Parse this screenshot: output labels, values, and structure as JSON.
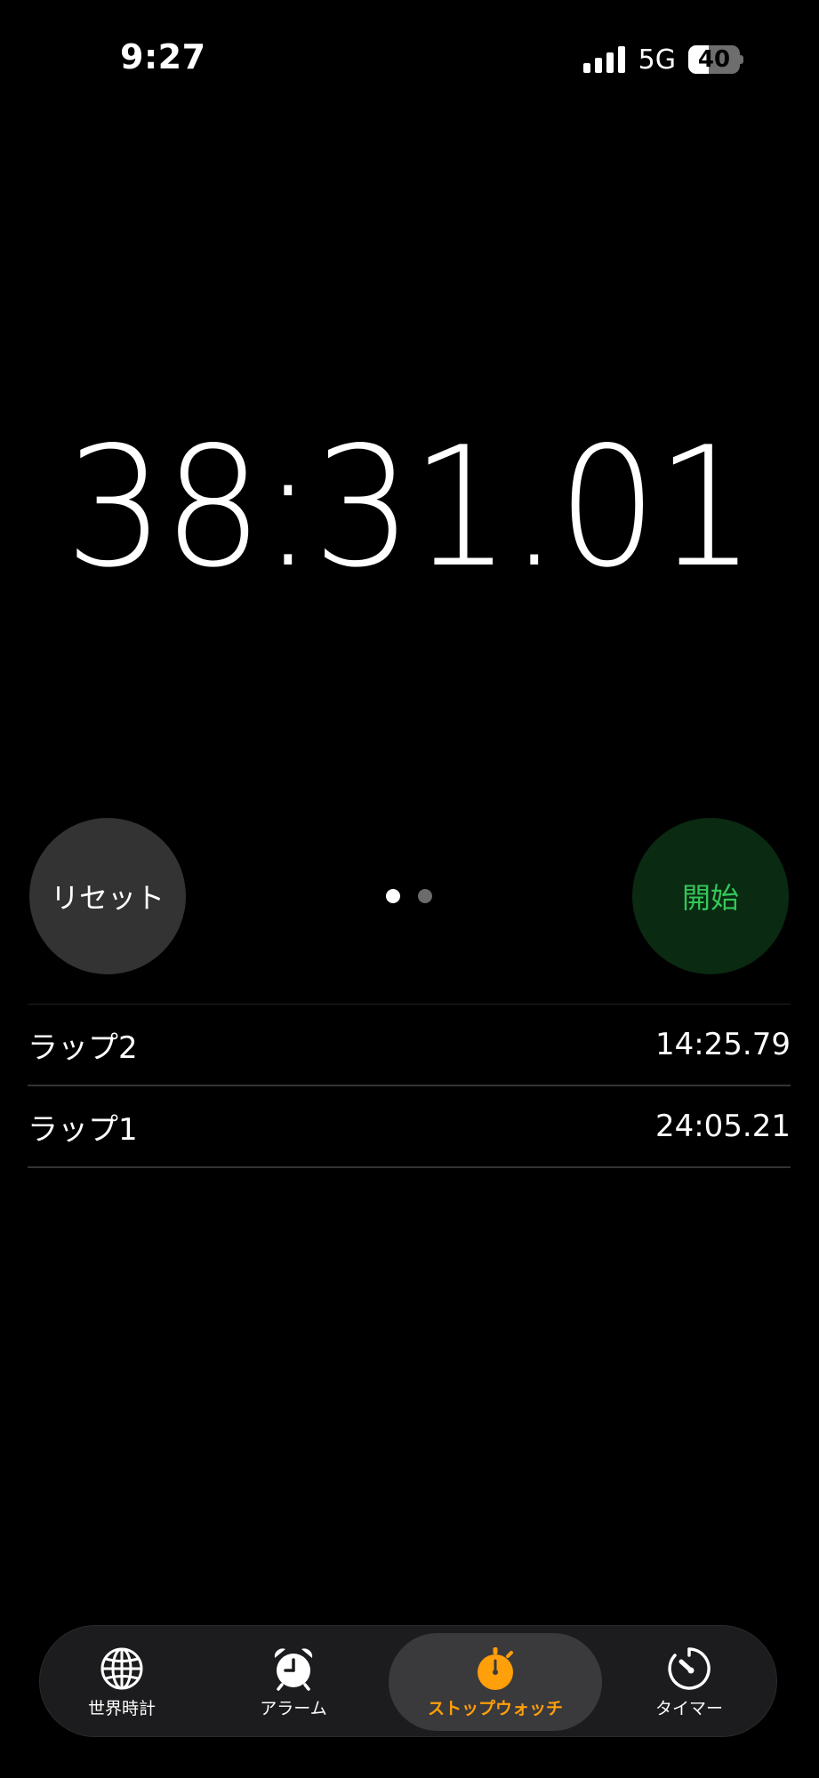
{
  "status_bar": {
    "time": "9:27",
    "network": "5G",
    "battery_level": 40,
    "battery_text": "40",
    "signal_bars": 4
  },
  "stopwatch": {
    "readout": "38:31.01"
  },
  "controls": {
    "reset_label": "リセット",
    "start_label": "開始",
    "page_count": 2,
    "active_page": 1
  },
  "laps": [
    {
      "label": "ラップ2",
      "time": "14:25.79"
    },
    {
      "label": "ラップ1",
      "time": "24:05.21"
    }
  ],
  "tabbar": {
    "tabs": [
      {
        "label": "世界時計",
        "icon": "globe-icon",
        "active": false
      },
      {
        "label": "アラーム",
        "icon": "alarm-clock-icon",
        "active": false
      },
      {
        "label": "ストップウォッチ",
        "icon": "stopwatch-icon",
        "active": true
      },
      {
        "label": "タイマー",
        "icon": "timer-icon",
        "active": false
      }
    ]
  },
  "colors": {
    "background": "#000000",
    "accent_orange": "#ff9f0a",
    "start_green": "#34c759",
    "start_bg": "#0a2a12",
    "reset_bg": "#333333"
  }
}
